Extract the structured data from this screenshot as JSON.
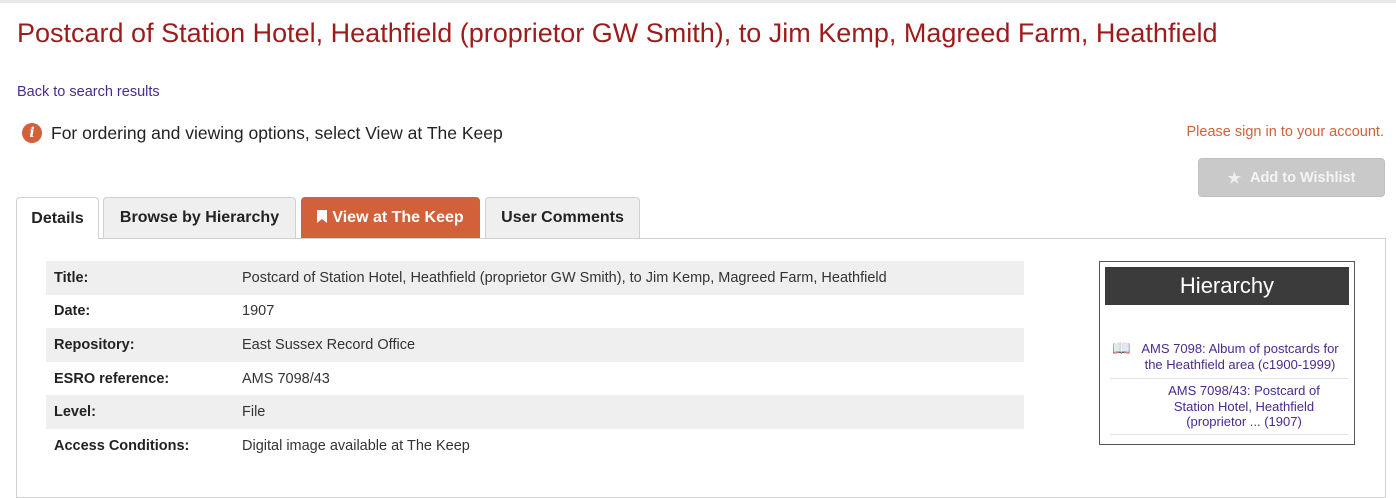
{
  "record_title": "Postcard of Station Hotel, Heathfield (proprietor GW Smith), to Jim Kemp, Magreed Farm, Heathfield",
  "back_link": "Back to search results",
  "info": {
    "icon": "info-circle-icon",
    "text": "For ordering and viewing options, select View at The Keep"
  },
  "signin_text": "Please sign in to your account.",
  "wishlist": {
    "icon": "star-icon",
    "label": "Add to Wishlist"
  },
  "tabs": {
    "details": "Details",
    "hierarchy": "Browse by Hierarchy",
    "keep": "View at The Keep",
    "keep_icon": "bookmark-icon",
    "comments": "User Comments"
  },
  "fields": [
    {
      "label": "Title:",
      "value": "Postcard of Station Hotel, Heathfield (proprietor GW Smith), to Jim Kemp, Magreed Farm, Heathfield"
    },
    {
      "label": "Date:",
      "value": "1907"
    },
    {
      "label": "Repository:",
      "value": "East Sussex Record Office"
    },
    {
      "label": "ESRO reference:",
      "value": "AMS 7098/43"
    },
    {
      "label": "Level:",
      "value": "File"
    },
    {
      "label": "Access Conditions:",
      "value": "Digital image available at The Keep"
    }
  ],
  "hierarchy": {
    "title": "Hierarchy",
    "items": [
      {
        "icon": "book-icon",
        "text": "AMS 7098: Album of postcards for the Heathfield area (c1900-1999)"
      },
      {
        "text": "AMS 7098/43: Postcard of Station Hotel, Heathfield (proprietor ... (1907)"
      }
    ]
  },
  "colors": {
    "title": "#9e1b1b",
    "accent": "#d2603a",
    "link": "#4a2a8c",
    "hierarchy_header": "#3b3b3b"
  }
}
